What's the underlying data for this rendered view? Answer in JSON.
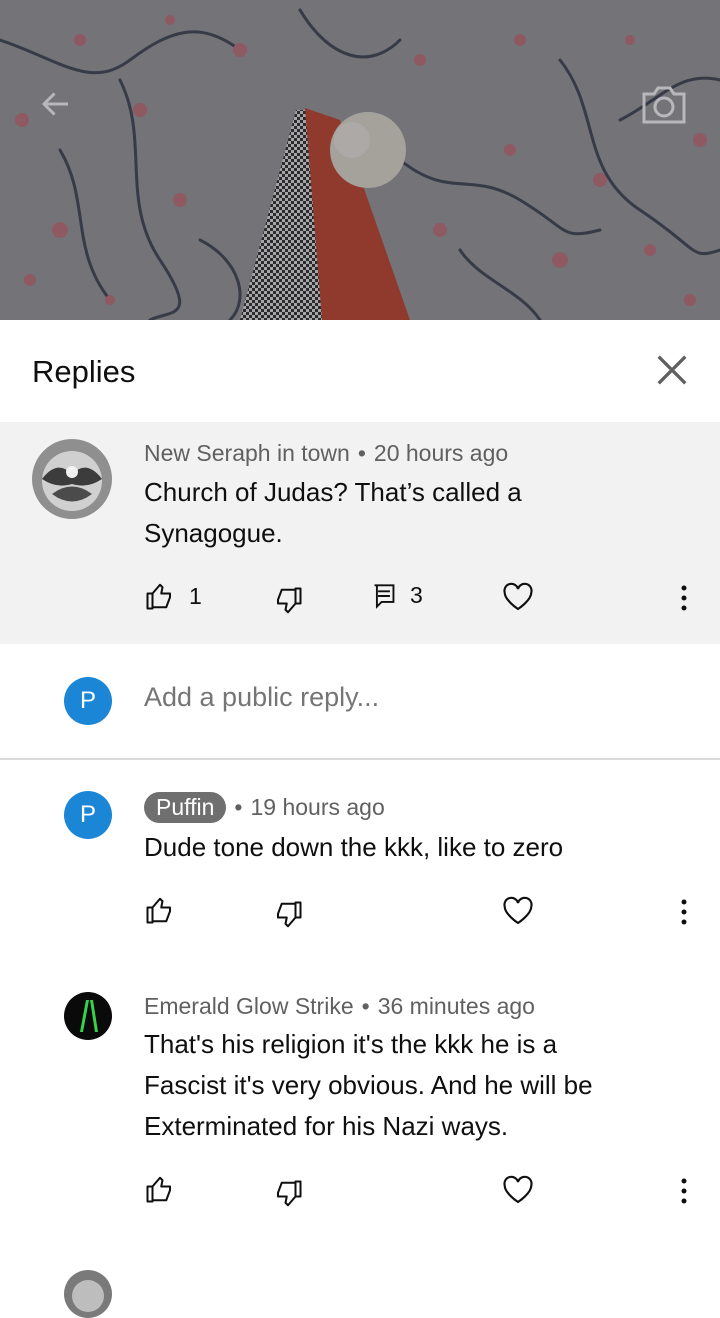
{
  "header": {
    "title": "Replies"
  },
  "parent_comment": {
    "author": "New Seraph in town",
    "time": "20 hours ago",
    "text": "Church of Judas? That’s called a Synagogue.",
    "likes": "1",
    "replies": "3"
  },
  "reply_box": {
    "avatar_letter": "P",
    "placeholder": "Add a public reply..."
  },
  "replies": [
    {
      "author": "Puffin",
      "time": "19 hours ago",
      "text": "Dude tone down the kkk, like to zero",
      "avatar_letter": "P"
    },
    {
      "author": "Emerald Glow Strike",
      "time": "36 minutes ago",
      "text": "That's his religion it's the kkk he is a Fascist it's very obvious. And he will be Exterminated for his Nazi ways."
    }
  ],
  "colors": {
    "avatar_blue": "#1c86d6",
    "parent_bg": "#f2f2f2",
    "badge_bg": "#6f6f6f"
  },
  "icons": [
    "back-arrow-icon",
    "camera-icon",
    "close-icon",
    "thumb-up-icon",
    "thumb-down-icon",
    "comment-icon",
    "heart-icon",
    "more-vert-icon"
  ]
}
